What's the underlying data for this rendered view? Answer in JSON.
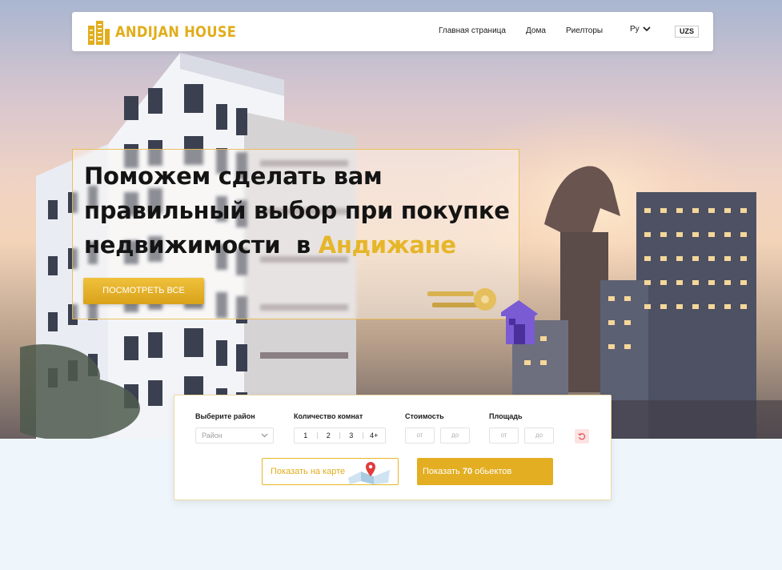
{
  "header": {
    "logo_text": "ANDIJAN HOUSE",
    "nav": {
      "home": "Главная страница",
      "houses": "Дома",
      "realtors": "Риелторы"
    },
    "language": "Ру",
    "currency": "UZS"
  },
  "hero": {
    "headline_part1": "Поможем сделать вам",
    "headline_part2": "правильный выбор при покупке",
    "headline_part3": "недвижимости  в",
    "headline_accent": "Андижане",
    "cta_label": "ПОСМОТРЕТЬ ВСЕ"
  },
  "search": {
    "district_label": "Выберите район",
    "district_placeholder": "Район",
    "rooms_label": "Количество комнат",
    "rooms_options": [
      "1",
      "2",
      "3",
      "4+"
    ],
    "price_label": "Стоимость",
    "price_from": "от",
    "price_to": "до",
    "area_label": "Площадь",
    "area_from": "от",
    "area_to": "до",
    "map_button": "Показать на карте",
    "show_prefix": "Показать",
    "show_count": "70",
    "show_suffix": "обьектов"
  },
  "colors": {
    "accent": "#e3ae22",
    "text": "#141414",
    "background": "#eef6fc"
  },
  "icons": [
    "building-logo-icon",
    "chevron-down-icon",
    "map-pin-icon",
    "reset-icon",
    "keys-icon"
  ]
}
